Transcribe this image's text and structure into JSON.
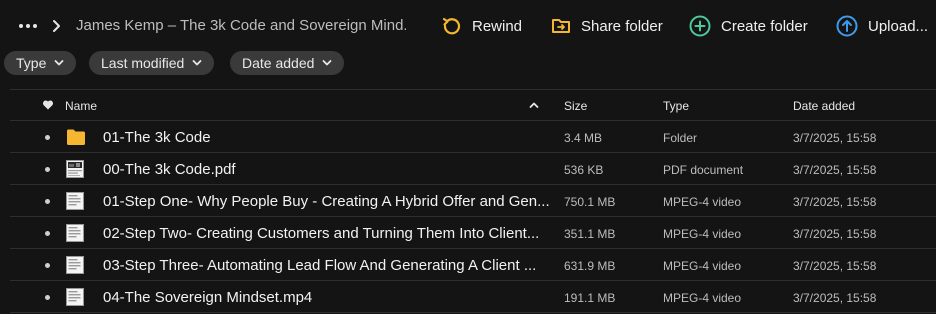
{
  "breadcrumb": {
    "title": "James Kemp – The 3k Code and Sovereign Mind..."
  },
  "toolbar": {
    "rewind": "Rewind",
    "share": "Share folder",
    "create": "Create folder",
    "upload": "Upload..."
  },
  "filters": {
    "type": "Type",
    "modified": "Last modified",
    "added": "Date added"
  },
  "table": {
    "columns": {
      "name": "Name",
      "size": "Size",
      "type": "Type",
      "date": "Date added"
    },
    "rows": [
      {
        "name": "01-The 3k Code",
        "size": "3.4 MB",
        "type": "Folder",
        "date": "3/7/2025, 15:58",
        "icon": "folder-icon"
      },
      {
        "name": "00-The 3k Code.pdf",
        "size": "536 KB",
        "type": "PDF document",
        "date": "3/7/2025, 15:58",
        "icon": "pdf-thumbnail-icon"
      },
      {
        "name": "01-Step One- Why People Buy - Creating A Hybrid Offer and Gen...",
        "size": "750.1 MB",
        "type": "MPEG-4 video",
        "date": "3/7/2025, 15:58",
        "icon": "document-icon"
      },
      {
        "name": "02-Step Two- Creating Customers and Turning Them Into Client...",
        "size": "351.1 MB",
        "type": "MPEG-4 video",
        "date": "3/7/2025, 15:58",
        "icon": "document-icon"
      },
      {
        "name": "03-Step Three- Automating Lead Flow And Generating A Client ...",
        "size": "631.9 MB",
        "type": "MPEG-4 video",
        "date": "3/7/2025, 15:58",
        "icon": "document-icon"
      },
      {
        "name": "04-The Sovereign Mindset.mp4",
        "size": "191.1 MB",
        "type": "MPEG-4 video",
        "date": "3/7/2025, 15:58",
        "icon": "document-icon"
      }
    ]
  },
  "colors": {
    "background": "#141414",
    "chip": "#3a3a3a",
    "accent_yellow": "#f5b731",
    "accent_green": "#4fc79a",
    "accent_blue": "#3d9be9",
    "folder": "#f5b731"
  }
}
